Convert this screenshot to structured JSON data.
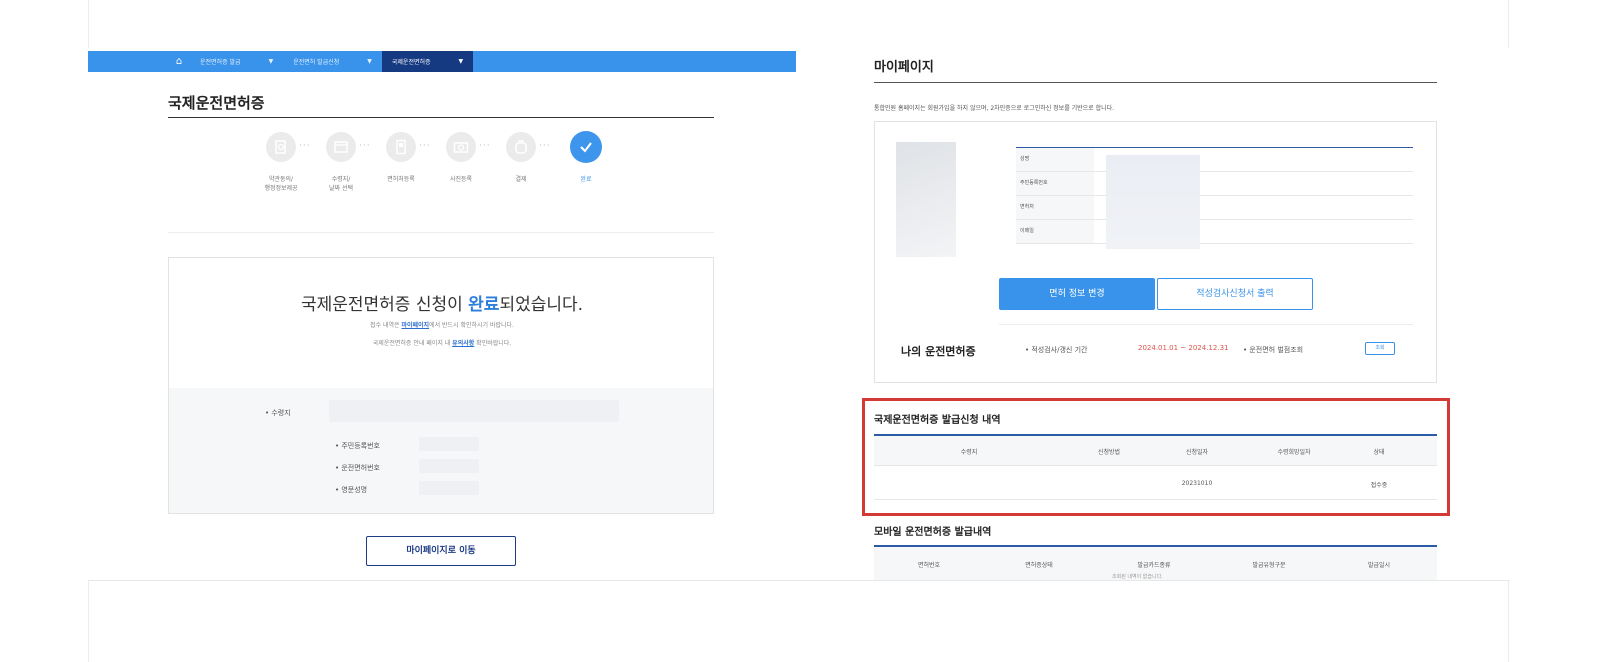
{
  "left": {
    "nav": {
      "home_icon": "home-icon",
      "items": [
        {
          "label": "운전면허증 발급",
          "arrow": "▼"
        },
        {
          "label": "운전면허 발급신청",
          "arrow": "▼"
        },
        {
          "label": "국제운전면허증",
          "arrow": "▼"
        }
      ]
    },
    "title": "국제운전면허증",
    "steps": [
      {
        "label": "약관동의/\n행정정보제공",
        "icon": "search-document-icon"
      },
      {
        "label": "수령지/\n날짜 선택",
        "icon": "calendar-icon"
      },
      {
        "label": "면허처등록",
        "icon": "id-card-icon"
      },
      {
        "label": "사진등록",
        "icon": "camera-icon"
      },
      {
        "label": "결제",
        "icon": "wallet-icon"
      },
      {
        "label": "완료",
        "icon": "check-icon"
      }
    ],
    "result": {
      "title_before": "국제운전면허증 신청이 ",
      "title_highlight": "완료",
      "title_after": "되었습니다.",
      "sub1_before": "접수 내역은 ",
      "sub1_link": "마이페이지",
      "sub1_after": "에서 반드시 확인하시기 바랍니다.",
      "sub2_before": "국제운전면허증 안내 페이지 내 ",
      "sub2_link": "유의사항",
      "sub2_after": " 확인바랍니다."
    },
    "info": {
      "receive_label": "• 수령지",
      "rrn_label": "• 주민등록번호",
      "license_label": "• 운전면허번호",
      "eng_name_label": "• 영문성명"
    },
    "move_button": "마이페이지로 이동"
  },
  "right": {
    "title": "마이페이지",
    "description": "통합민원 홈페이지는 회원가입을 하지 않으며, 2차인증으로 로그인하신 정보를 기반으로 합니다.",
    "profile_rows": [
      "성명",
      "주민등록번호",
      "면허처",
      "이메일"
    ],
    "btn_change": "면허 정보 변경",
    "btn_print": "적성검사신청서 출력",
    "license": {
      "title": "나의 운전면허증",
      "period_label": "• 적성검사/갱신 기간",
      "period_value": "2024.01.01 ~ 2024.12.31",
      "check_label": "• 운전면허 벌점조회",
      "check_button": "조회"
    },
    "intl": {
      "title": "국제운전면허증 발급신청 내역",
      "headers": [
        "수령지",
        "신청방법",
        "신청일자",
        "수령희망일자",
        "상태"
      ],
      "row": {
        "date": "20231010",
        "status": "접수중"
      }
    },
    "mobile": {
      "title": "모바일 운전면허증 발급내역",
      "headers": [
        "면허번호",
        "면허증상태",
        "발급카드종류",
        "발급유형구분",
        "발급일시"
      ],
      "trailing": "조회된 내역이 없습니다."
    }
  },
  "colors": {
    "nav_blue": "#3a93ea",
    "nav_active": "#163a82",
    "highlight_blue": "#2d7fdc",
    "period_red": "#e0544c",
    "highlight_box": "#d33a35"
  }
}
